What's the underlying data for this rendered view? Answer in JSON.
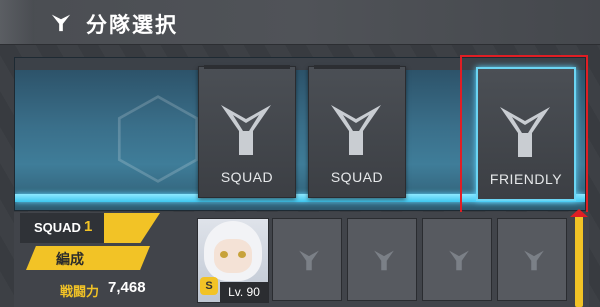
{
  "header": {
    "title": "分隊選択",
    "icon": "squad-emblem-icon"
  },
  "squad_cards": [
    {
      "label": "SQUAD",
      "icon": "squad-emblem-icon",
      "selected": false
    },
    {
      "label": "SQUAD",
      "icon": "squad-emblem-icon",
      "selected": false
    },
    {
      "label": "FRIENDLY",
      "icon": "squad-emblem-icon",
      "selected": true
    }
  ],
  "squad_info": {
    "label": "SQUAD",
    "number": "1",
    "edit_label": "編成",
    "power_label": "戦闘力",
    "power_value": "7,468"
  },
  "member": {
    "level": "Lv. 90",
    "rank_icon": "rank-badge-icon"
  },
  "colors": {
    "accent": "#f2c326",
    "selection_glow": "#6cd5f3",
    "highlight_box": "#e01e24"
  }
}
